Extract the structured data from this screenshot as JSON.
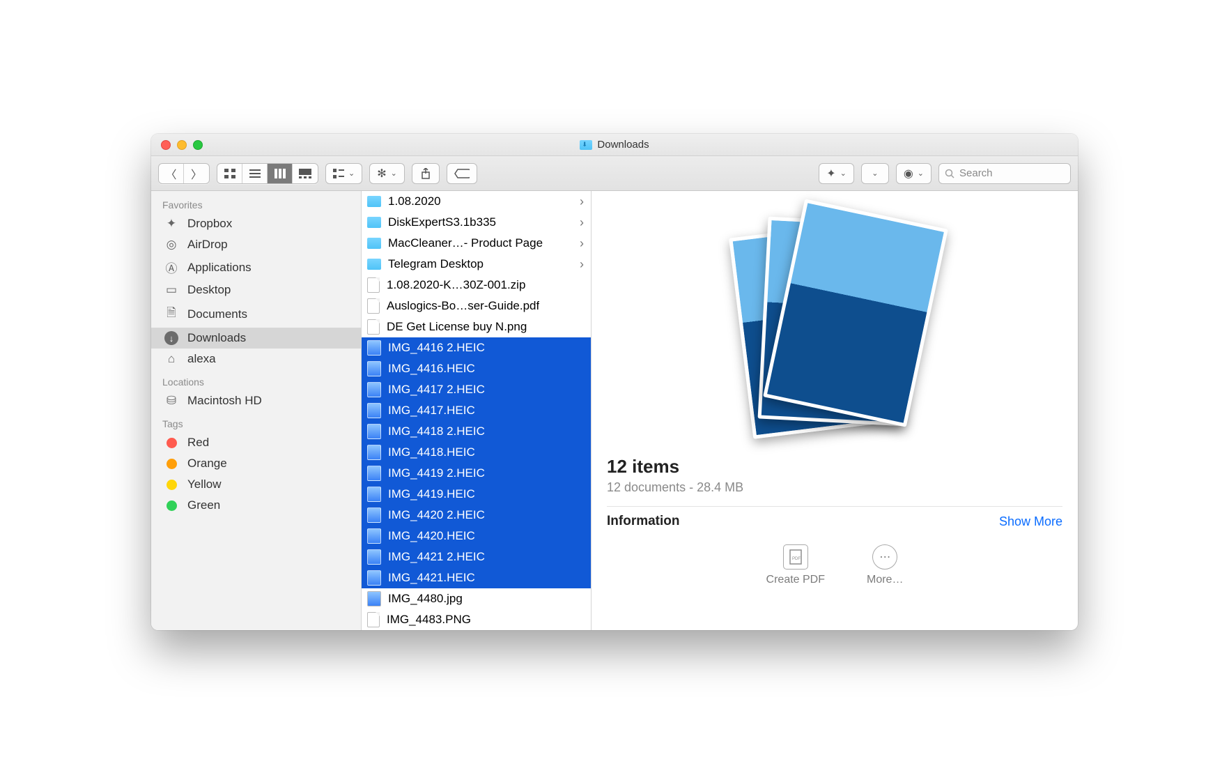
{
  "window": {
    "title": "Downloads"
  },
  "search": {
    "placeholder": "Search"
  },
  "sidebar": {
    "sections": [
      {
        "header": "Favorites",
        "items": [
          {
            "label": "Dropbox",
            "icon": "dropbox-icon"
          },
          {
            "label": "AirDrop",
            "icon": "airdrop-icon"
          },
          {
            "label": "Applications",
            "icon": "applications-icon"
          },
          {
            "label": "Desktop",
            "icon": "desktop-icon"
          },
          {
            "label": "Documents",
            "icon": "documents-icon"
          },
          {
            "label": "Downloads",
            "icon": "downloads-icon",
            "active": true
          },
          {
            "label": "alexa",
            "icon": "home-icon"
          }
        ]
      },
      {
        "header": "Locations",
        "items": [
          {
            "label": "Macintosh HD",
            "icon": "disk-icon"
          }
        ]
      },
      {
        "header": "Tags",
        "items": [
          {
            "label": "Red",
            "color": "#ff5b4f"
          },
          {
            "label": "Orange",
            "color": "#ff9f0a"
          },
          {
            "label": "Yellow",
            "color": "#ffd60a"
          },
          {
            "label": "Green",
            "color": "#30d158"
          }
        ]
      }
    ]
  },
  "list": [
    {
      "name": "1.08.2020",
      "type": "folder"
    },
    {
      "name": "DiskExpertS3.1b335",
      "type": "folder"
    },
    {
      "name": "MacCleaner…- Product Page",
      "type": "folder"
    },
    {
      "name": "Telegram Desktop",
      "type": "folder"
    },
    {
      "name": "1.08.2020-K…30Z-001.zip",
      "type": "zip"
    },
    {
      "name": "Auslogics-Bo…ser-Guide.pdf",
      "type": "pdf"
    },
    {
      "name": "DE Get License buy N.png",
      "type": "png"
    },
    {
      "name": "IMG_4416 2.HEIC",
      "type": "heic",
      "selected": true
    },
    {
      "name": "IMG_4416.HEIC",
      "type": "heic",
      "selected": true
    },
    {
      "name": "IMG_4417 2.HEIC",
      "type": "heic",
      "selected": true
    },
    {
      "name": "IMG_4417.HEIC",
      "type": "heic",
      "selected": true
    },
    {
      "name": "IMG_4418 2.HEIC",
      "type": "heic",
      "selected": true
    },
    {
      "name": "IMG_4418.HEIC",
      "type": "heic",
      "selected": true
    },
    {
      "name": "IMG_4419 2.HEIC",
      "type": "heic",
      "selected": true
    },
    {
      "name": "IMG_4419.HEIC",
      "type": "heic",
      "selected": true
    },
    {
      "name": "IMG_4420 2.HEIC",
      "type": "heic",
      "selected": true
    },
    {
      "name": "IMG_4420.HEIC",
      "type": "heic",
      "selected": true
    },
    {
      "name": "IMG_4421 2.HEIC",
      "type": "heic",
      "selected": true
    },
    {
      "name": "IMG_4421.HEIC",
      "type": "heic",
      "selected": true
    },
    {
      "name": "IMG_4480.jpg",
      "type": "jpg"
    },
    {
      "name": "IMG_4483.PNG",
      "type": "png"
    }
  ],
  "preview": {
    "title": "12 items",
    "subtitle": "12 documents - 28.4 MB",
    "info_label": "Information",
    "show_more": "Show More",
    "actions": {
      "create_pdf": "Create PDF",
      "more": "More…"
    }
  }
}
